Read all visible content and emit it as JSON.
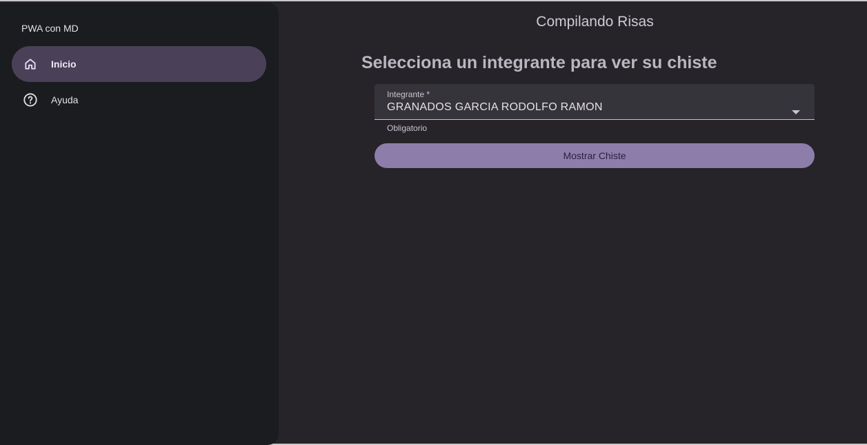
{
  "drawer": {
    "title": "PWA con MD",
    "items": [
      {
        "label": "Inicio",
        "icon": "home-icon",
        "active": true
      },
      {
        "label": "Ayuda",
        "icon": "help-circle-icon",
        "active": false
      }
    ]
  },
  "header": {
    "title": "Compilando Risas"
  },
  "main": {
    "heading": "Selecciona un integrante para ver su chiste",
    "select": {
      "label": "Integrante *",
      "value": "GRANADOS GARCIA RODOLFO RAMON",
      "helper": "Obligatorio"
    },
    "button_label": "Mostrar Chiste"
  },
  "colors": {
    "background": "#262329",
    "drawer": "#1b1c1f",
    "active_item": "#4a4158",
    "accent": "#8d7dab"
  }
}
